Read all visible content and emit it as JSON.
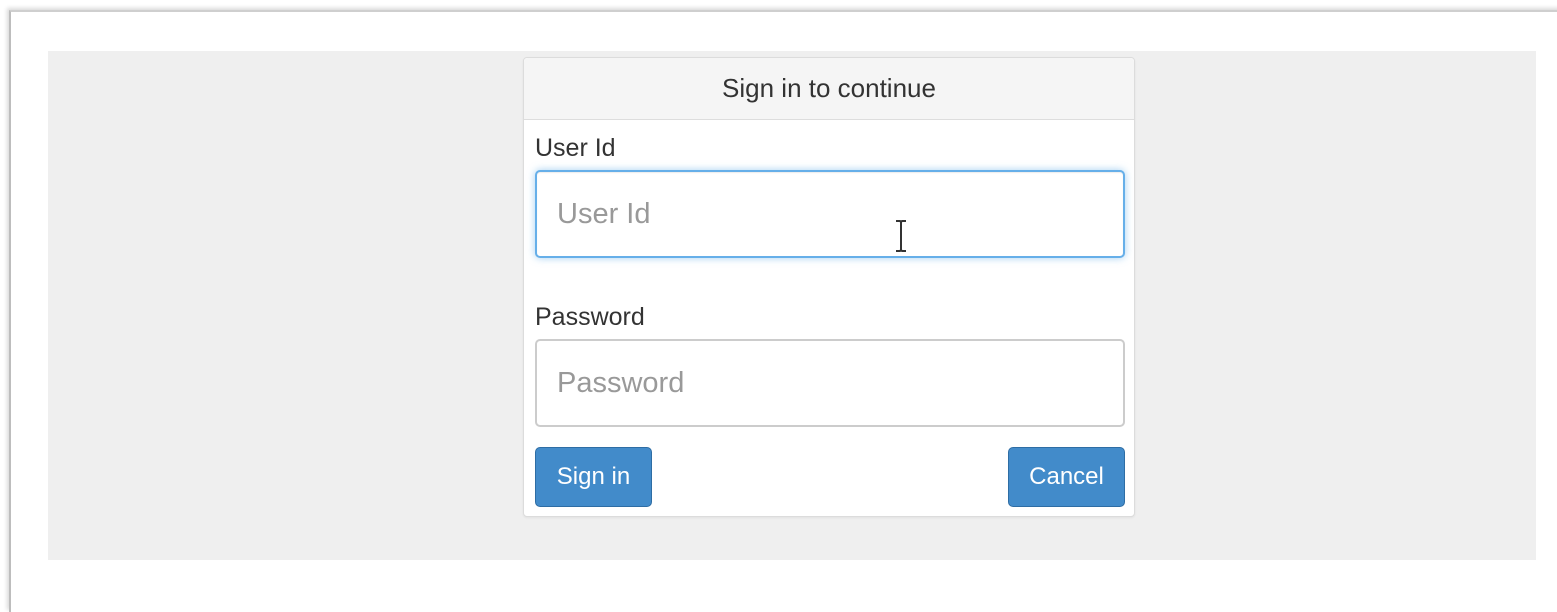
{
  "login": {
    "heading": "Sign in to continue",
    "user_id": {
      "label": "User Id",
      "placeholder": "User Id",
      "value": ""
    },
    "password": {
      "label": "Password",
      "placeholder": "Password",
      "value": ""
    },
    "sign_in_label": "Sign in",
    "cancel_label": "Cancel"
  },
  "icons": {
    "cursor": "text-cursor-icon"
  },
  "colors": {
    "page_background": "#efefef",
    "panel_heading_background": "#f5f5f5",
    "button_primary": "#428bca",
    "focus_border": "#66afe9"
  }
}
